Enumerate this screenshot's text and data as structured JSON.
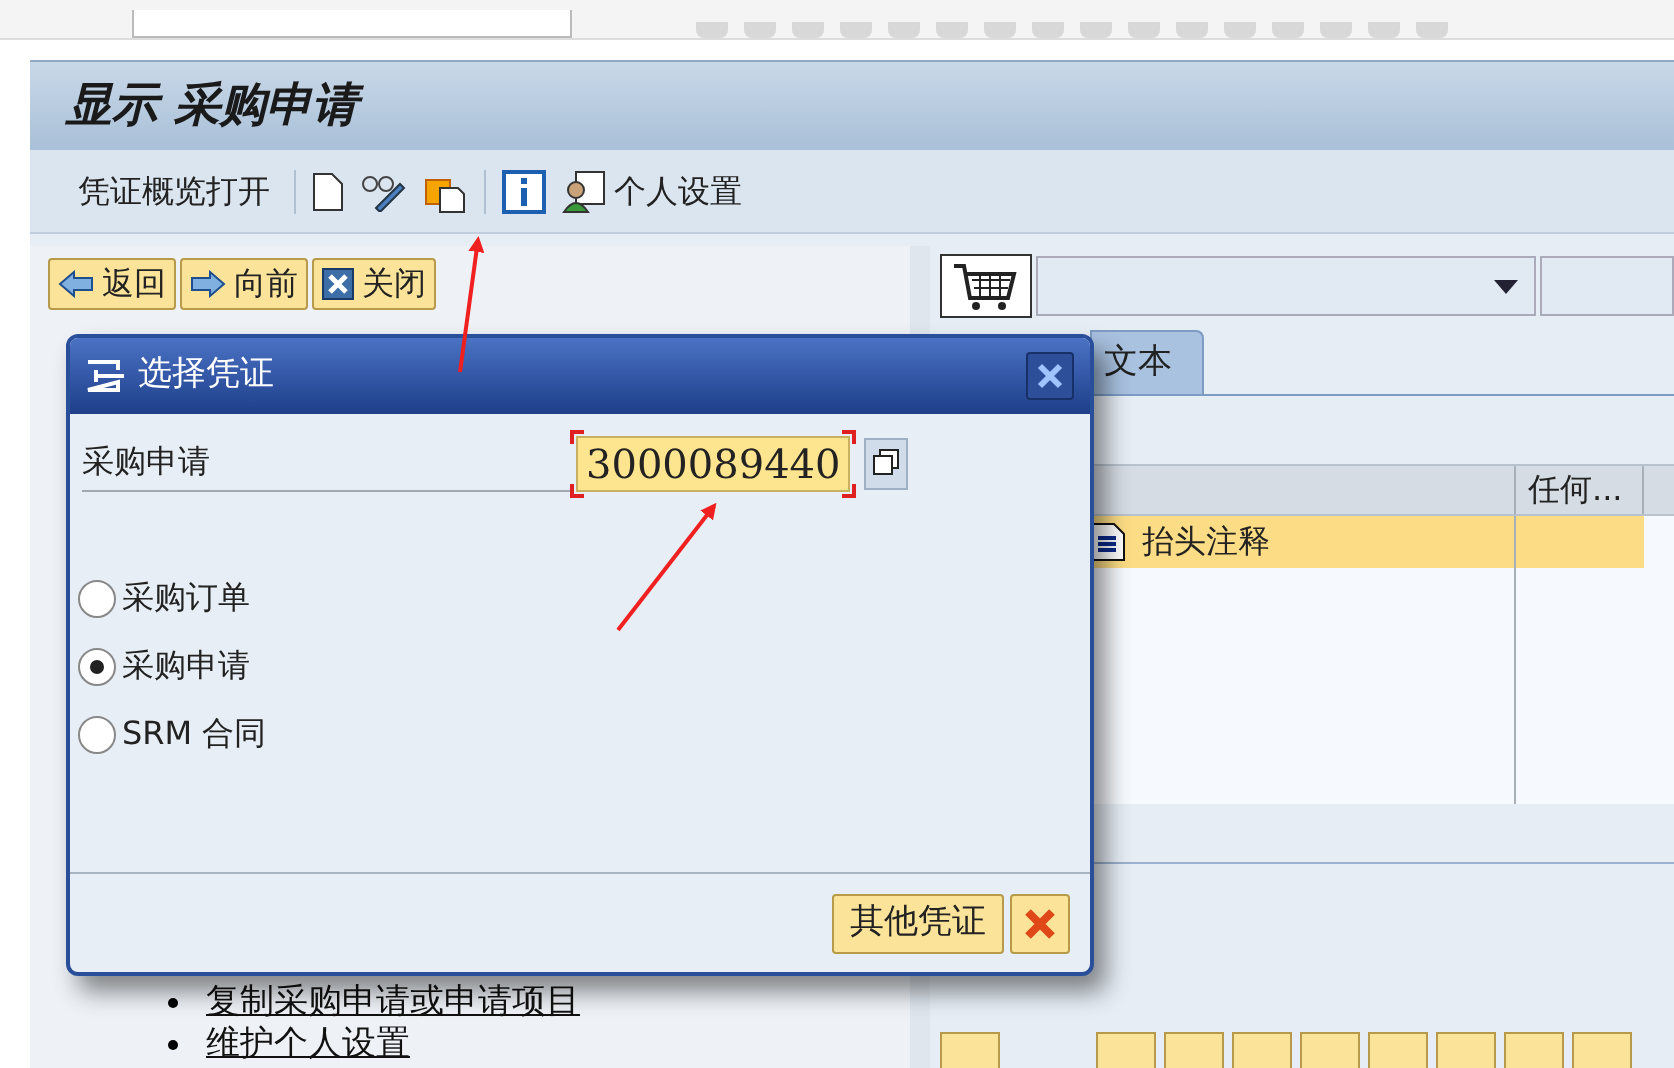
{
  "title": "显示 采购申请",
  "app_toolbar": {
    "label": "凭证概览打开",
    "settings_label": "个人设置"
  },
  "nav_buttons": [
    {
      "label": "返回",
      "kind": "back"
    },
    {
      "label": "向前",
      "kind": "forward"
    },
    {
      "label": "关闭",
      "kind": "close"
    }
  ],
  "links": [
    "复制采购申请或申请项目",
    "维护个人设置"
  ],
  "right_panel": {
    "tabs": [
      {
        "label": "文本",
        "selected": true
      }
    ],
    "table": {
      "column_2": "任何...",
      "rows": [
        {
          "text": "抬头注释",
          "selected": true
        }
      ]
    }
  },
  "dialog": {
    "title": "选择凭证",
    "field": {
      "label": "采购申请",
      "value": "3000089440",
      "focused": true
    },
    "options": [
      {
        "label": "采购订单",
        "selected": false
      },
      {
        "label": "采购申请",
        "selected": true
      },
      {
        "label": "SRM 合同",
        "selected": false
      }
    ],
    "ok_button": {
      "label": "其他凭证"
    }
  }
}
